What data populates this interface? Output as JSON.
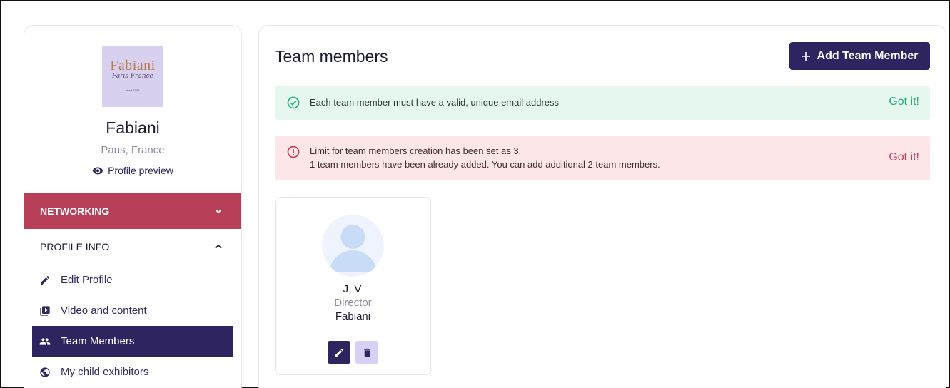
{
  "profile": {
    "logo_text": "Fabiani",
    "logo_script": "Paris France",
    "logo_since": "since 1986",
    "name": "Fabiani",
    "location": "Paris, France",
    "preview_label": "Profile preview"
  },
  "sidebar": {
    "networking_label": "NETWORKING",
    "profile_info_label": "PROFILE INFO",
    "items": [
      {
        "label": "Edit Profile",
        "icon": "pencil-icon"
      },
      {
        "label": "Video and content",
        "icon": "video-library-icon"
      },
      {
        "label": "Team Members",
        "icon": "people-icon",
        "active": true
      },
      {
        "label": "My child exhibitors",
        "icon": "globe-icon"
      }
    ]
  },
  "main": {
    "title": "Team members",
    "add_button_label": "Add Team Member",
    "alerts": {
      "info": {
        "text": "Each team member must have a valid, unique email address",
        "action": "Got it!"
      },
      "limit": {
        "line1": "Limit for team members creation has been set as 3.",
        "line2": "1 team members have been already added. You can add additional 2 team members.",
        "action": "Got it!"
      }
    },
    "members": [
      {
        "name": "J V",
        "role": "Director",
        "company": "Fabiani"
      }
    ]
  },
  "colors": {
    "primary": "#2d2460",
    "networking": "#b83f58",
    "success_bg": "#e6f7f0",
    "success": "#27ae72",
    "error_bg": "#fde6e8",
    "error": "#c43a55",
    "delete_bg": "#d8d0f5"
  }
}
